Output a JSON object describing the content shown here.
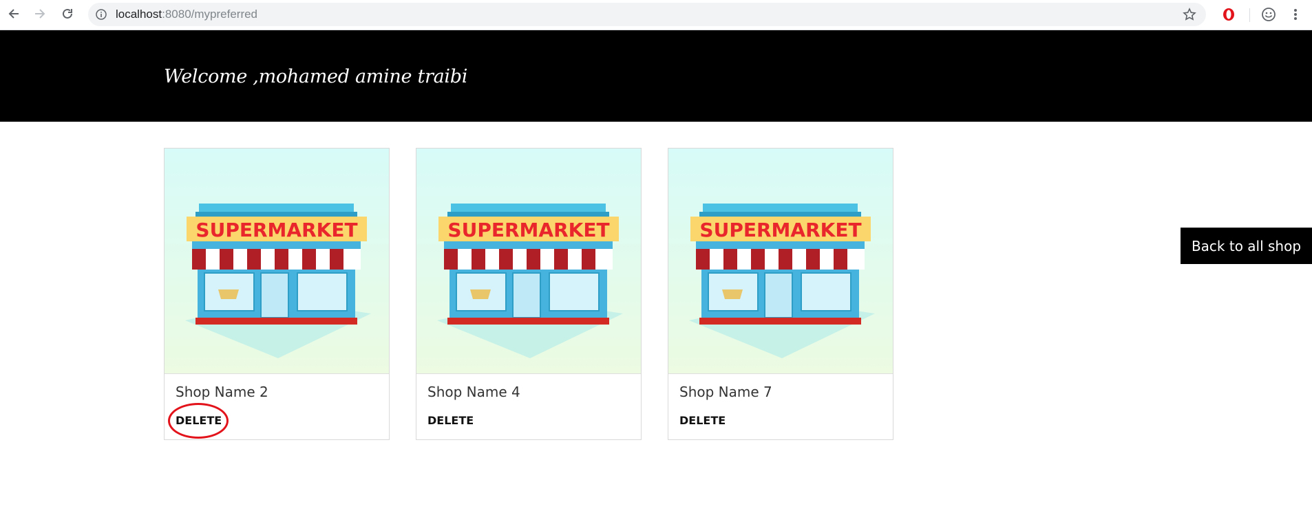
{
  "browser": {
    "url_host": "localhost",
    "url_rest": ":8080/mypreferred"
  },
  "header": {
    "welcome": "Welcome ,mohamed amine traibi"
  },
  "cards": [
    {
      "image_text": "SUPERMARKET",
      "title": "Shop Name 2",
      "delete_label": "DELETE"
    },
    {
      "image_text": "SUPERMARKET",
      "title": "Shop Name 4",
      "delete_label": "DELETE"
    },
    {
      "image_text": "SUPERMARKET",
      "title": "Shop Name 7",
      "delete_label": "DELETE"
    }
  ],
  "back_button": {
    "label": "Back to all shop"
  },
  "colors": {
    "header_bg": "#000000",
    "highlight": "#e3131b",
    "sign_text": "#e8262b",
    "sign_bg": "#fbd66d",
    "building": "#46b3df"
  }
}
